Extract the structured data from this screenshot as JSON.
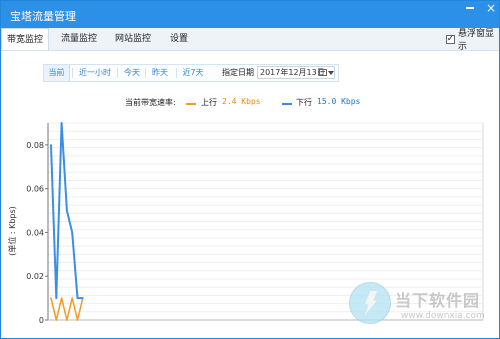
{
  "window": {
    "title": "宝塔流量管理",
    "minimize_label": "—",
    "close_label": "×"
  },
  "tabs": [
    {
      "label": "带宽监控",
      "active": true
    },
    {
      "label": "流量监控",
      "active": false
    },
    {
      "label": "网站监控",
      "active": false
    },
    {
      "label": "设置",
      "active": false
    }
  ],
  "floating_window": {
    "label": "悬浮窗显示",
    "checked": true,
    "check_mark": "✓"
  },
  "range": {
    "buttons": [
      {
        "label": "当前",
        "active": true
      },
      {
        "label": "近一小时",
        "active": false
      },
      {
        "label": "今天",
        "active": false
      },
      {
        "label": "昨天",
        "active": false
      },
      {
        "label": "近7天",
        "active": false
      }
    ],
    "date_label": "指定日期",
    "date_value": "2017年12月13日"
  },
  "speed": {
    "label": "当前带宽速率:",
    "up_label": "上行",
    "up_value": "2.4 Kbps",
    "down_label": "下行",
    "down_value": "15.0 Kbps",
    "up_color": "#f39a22",
    "down_color": "#3b8ee6"
  },
  "chart_data": {
    "type": "line",
    "ylabel": "(单位 : Kbps)",
    "ylim": [
      0,
      0.09
    ],
    "yticks": [
      "0",
      "0.02",
      "0.04",
      "0.06",
      "0.08"
    ],
    "grid": true,
    "x": [
      0,
      1,
      2,
      3,
      4,
      5,
      6
    ],
    "series": [
      {
        "name": "上行",
        "color": "#f39a22",
        "values": [
          0.01,
          0.0,
          0.01,
          0.0,
          0.01,
          0.0,
          0.01
        ]
      },
      {
        "name": "下行",
        "color": "#3b8ee6",
        "values": [
          0.08,
          0.01,
          0.09,
          0.05,
          0.04,
          0.01,
          0.01
        ]
      }
    ]
  },
  "watermark": {
    "text": "当下软件园",
    "url": "www.downxia.com"
  }
}
